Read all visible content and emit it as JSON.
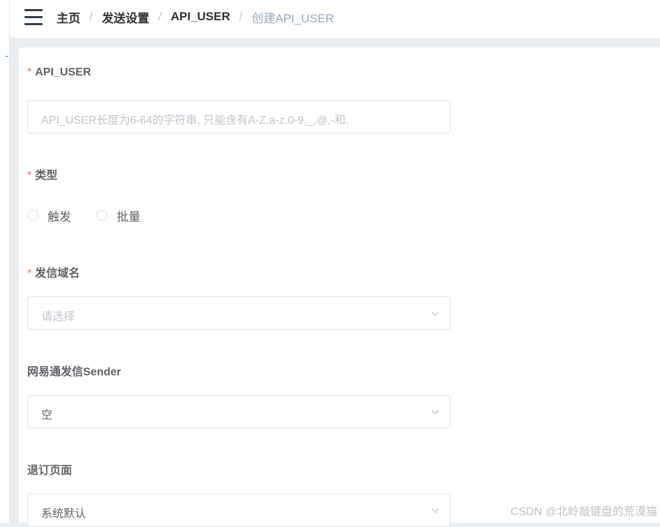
{
  "breadcrumb": {
    "items": [
      "主页",
      "发送设置",
      "API_USER"
    ],
    "current": "创建API_USER",
    "separator": "/"
  },
  "form": {
    "api_user": {
      "label": "API_USER",
      "required_mark": "*",
      "placeholder": "API_USER长度为6-64的字符串, 只能含有A-Z,a-z,0-9,_,@,-和."
    },
    "type": {
      "label": "类型",
      "required_mark": "*",
      "options": [
        "触发",
        "批量"
      ]
    },
    "domain": {
      "label": "发信域名",
      "required_mark": "*",
      "placeholder": "请选择"
    },
    "sender": {
      "label": "网易通发信Sender",
      "value": "空"
    },
    "unsubscribe": {
      "label": "退订页面",
      "value": "系统默认"
    }
  },
  "watermark": "CSDN @北岭敲键盘的荒漠猫",
  "colors": {
    "required": "#f56c6c",
    "border": "#dcdfe6",
    "placeholder": "#c0c4cc",
    "breadcrumb_current": "#97a8be",
    "background": "#e9eef3"
  }
}
